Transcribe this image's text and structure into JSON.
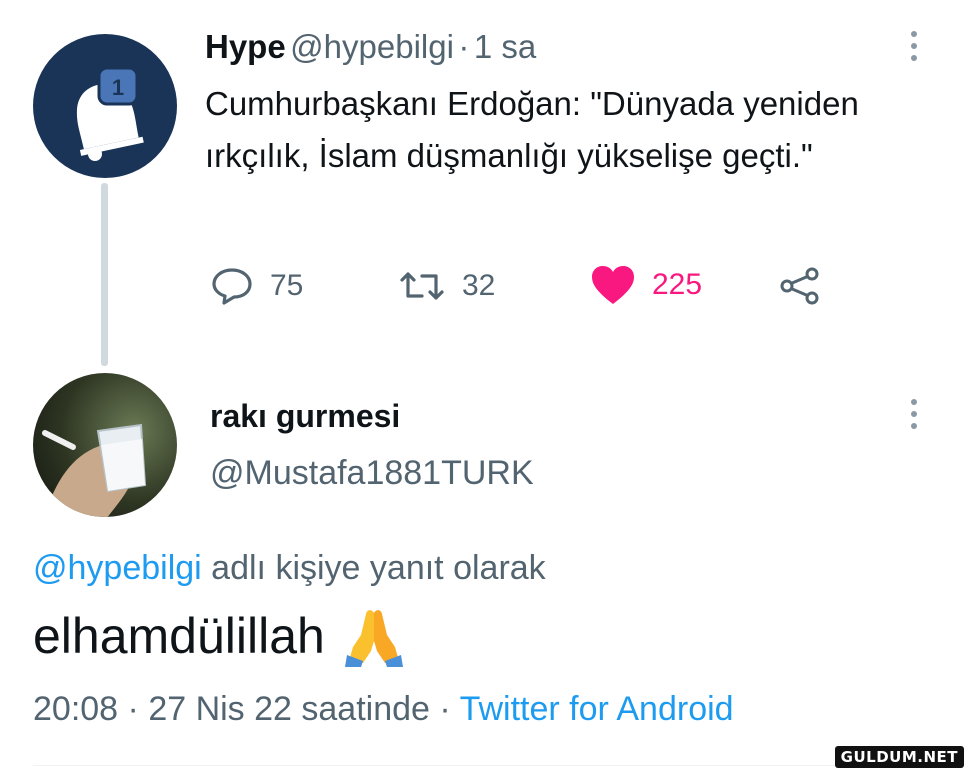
{
  "parent_tweet": {
    "author_name": "Hype",
    "author_handle": "@hypebilgi",
    "time_sep": "·",
    "time": "1 sa",
    "badge_count": "1",
    "text": "Cumhurbaşkanı Erdoğan: \"Dünyada yeniden ırkçılık, İslam düşmanlığı yükselişe geçti.\"",
    "actions": {
      "replies": "75",
      "retweets": "32",
      "likes": "225"
    }
  },
  "reply_tweet": {
    "author_name": "rakı gurmesi",
    "author_handle": "@Mustafa1881TURK",
    "reply_mention": "@hypebilgi",
    "reply_suffix": " adlı kişiye yanıt olarak",
    "text": "elhamdülillah",
    "emoji": "🙏",
    "time": "20:08",
    "date": "27 Nis 22 saatinde",
    "meta_sep": " · ",
    "source": "Twitter for Android"
  },
  "watermark": "GULDUM.NET",
  "colors": {
    "accent": "#1d9bf0",
    "like": "#f91880",
    "muted": "#536471",
    "avatar_bg": "#1a3458"
  },
  "icons": [
    "bell-icon",
    "more-icon",
    "reply-icon",
    "retweet-icon",
    "like-icon",
    "share-icon"
  ]
}
